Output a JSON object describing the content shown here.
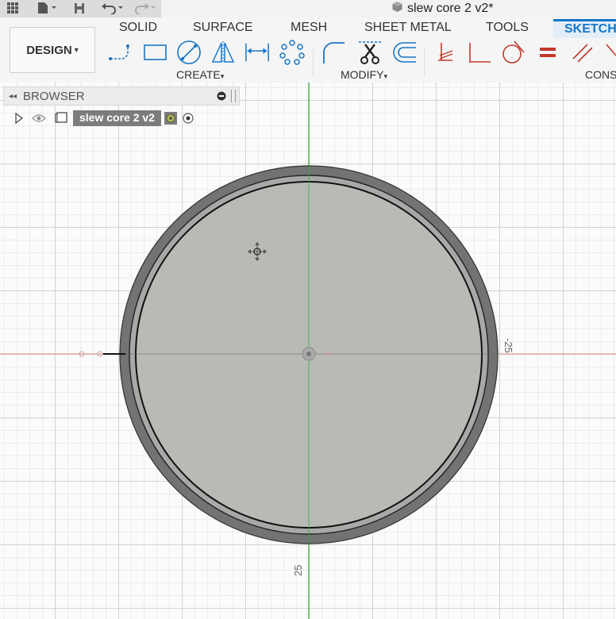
{
  "document": {
    "title": "slew core 2 v2*"
  },
  "workspace": {
    "label": "DESIGN",
    "caret": "▾"
  },
  "tabs": [
    "SOLID",
    "SURFACE",
    "MESH",
    "SHEET METAL",
    "TOOLS",
    "SKETCH"
  ],
  "groups": {
    "create": "CREATE",
    "modify": "MODIFY",
    "constrain": "CONS"
  },
  "caret": "▾",
  "browser": {
    "title": "BROWSER",
    "component": "slew core 2 v2"
  },
  "dimensions": {
    "right": "-25",
    "bottom": "25"
  },
  "icons": {
    "app_menu": "grid-icon",
    "file": "file-icon",
    "save": "save-icon",
    "undo": "undo-icon",
    "redo": "redo-icon",
    "document": "cube-icon"
  },
  "colors": {
    "accent": "#1677c6",
    "sketch_fill": "#b9bab6",
    "outer_ring": "#6f6f6f",
    "x_axis": "#e08080",
    "y_axis": "#3aa83a",
    "constraint_red": "#c0392b"
  }
}
